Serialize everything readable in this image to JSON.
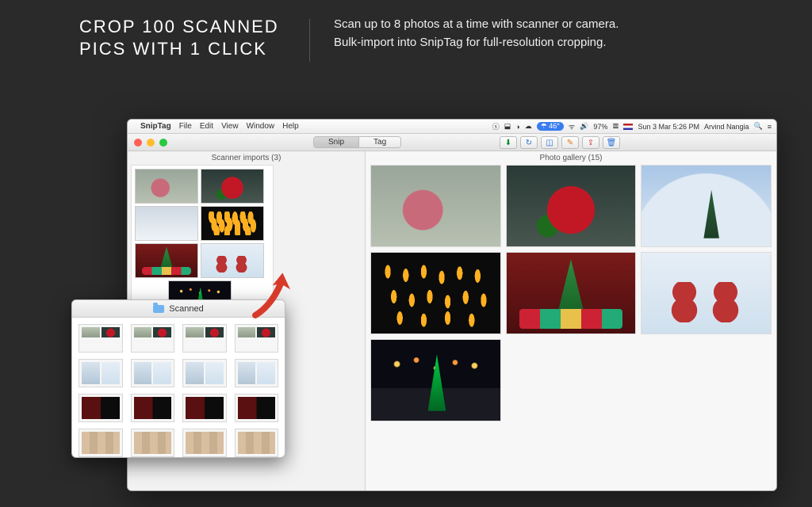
{
  "marketing": {
    "headline": "CROP 100 SCANNED PICS WITH 1 CLICK",
    "sub_line1": "Scan up to 8 photos at a time with scanner or camera.",
    "sub_line2": "Bulk-import into SnipTag for full-resolution cropping."
  },
  "menubar": {
    "app_name": "SnipTag",
    "menus": [
      "File",
      "Edit",
      "View",
      "Window",
      "Help"
    ],
    "weather": "46°",
    "battery": "97%",
    "clock": "Sun 3 Mar  5:26 PM",
    "user": "Arvind Nangia"
  },
  "window": {
    "seg_tabs": {
      "snip": "Snip",
      "tag": "Tag"
    },
    "toolbar_icons": [
      "import",
      "rotate",
      "crop",
      "edit",
      "export",
      "delete"
    ],
    "left_label": "Scanner imports (3)",
    "right_label": "Photo gallery (15)"
  },
  "finder": {
    "title": "Scanned"
  },
  "colors": {
    "accent_red": "#d73a2a",
    "bg_dark": "#2a2a2a"
  }
}
